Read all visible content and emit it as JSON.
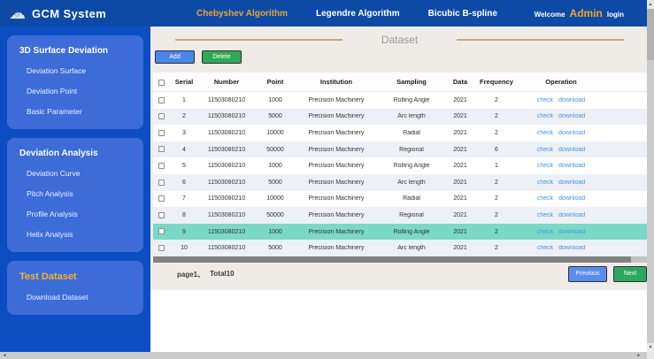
{
  "header": {
    "app_title": "GCM System",
    "nav": [
      {
        "label": "Chebyshev Algorithm",
        "active": true
      },
      {
        "label": "Legendre Algorithm",
        "active": false
      },
      {
        "label": "Bicubic B-spline",
        "active": false
      }
    ],
    "welcome": "Welcome",
    "user": "Admin",
    "login": "login"
  },
  "sidebar": {
    "sections": [
      {
        "title": "3D Surface Deviation",
        "accent": false,
        "items": [
          "Deviation Surface",
          "Deviation Point",
          "Basic Parameter"
        ]
      },
      {
        "title": "Deviation Analysis",
        "accent": false,
        "items": [
          "Deviation Curve",
          "Pitch Analysis",
          "Profile Analysis",
          "Helix Analysis"
        ]
      },
      {
        "title": "Test Dataset",
        "accent": true,
        "items": [
          "Download Dataset"
        ]
      }
    ]
  },
  "main": {
    "title": "Dataset",
    "toolbar": {
      "add": "Add",
      "delete": "Delete"
    },
    "table": {
      "headers": [
        "Serial",
        "Number",
        "Point",
        "Institution",
        "Sampling",
        "Data",
        "Frequency",
        "Operation"
      ],
      "operation_links": [
        "check",
        "download"
      ],
      "rows": [
        {
          "serial": "1",
          "number": "11503080210",
          "point": "1000",
          "institution": "Precision Machinery",
          "sampling": "Rolling Angle",
          "data": "2021",
          "frequency": "2",
          "highlighted": false
        },
        {
          "serial": "2",
          "number": "11503080210",
          "point": "5000",
          "institution": "Precision Machinery",
          "sampling": "Arc length",
          "data": "2021",
          "frequency": "2",
          "highlighted": false
        },
        {
          "serial": "3",
          "number": "11503080210",
          "point": "10000",
          "institution": "Precision Machinery",
          "sampling": "Radial",
          "data": "2021",
          "frequency": "2",
          "highlighted": false
        },
        {
          "serial": "4",
          "number": "11503080210",
          "point": "50000",
          "institution": "Precision Machinery",
          "sampling": "Regional",
          "data": "2021",
          "frequency": "6",
          "highlighted": false
        },
        {
          "serial": "5",
          "number": "11503080210",
          "point": "1000",
          "institution": "Precision Machinery",
          "sampling": "Rolling Angle",
          "data": "2021",
          "frequency": "1",
          "highlighted": false
        },
        {
          "serial": "6",
          "number": "11503080210",
          "point": "5000",
          "institution": "Precision Machinery",
          "sampling": "Arc length",
          "data": "2021",
          "frequency": "2",
          "highlighted": false
        },
        {
          "serial": "7",
          "number": "11503080210",
          "point": "10000",
          "institution": "Precision Machinery",
          "sampling": "Radial",
          "data": "2021",
          "frequency": "2",
          "highlighted": false
        },
        {
          "serial": "8",
          "number": "11503080210",
          "point": "50000",
          "institution": "Precision Machinery",
          "sampling": "Regional",
          "data": "2021",
          "frequency": "2",
          "highlighted": false
        },
        {
          "serial": "9",
          "number": "11503080210",
          "point": "1000",
          "institution": "Precision Machinery",
          "sampling": "Rolling Angle",
          "data": "2021",
          "frequency": "2",
          "highlighted": true
        },
        {
          "serial": "10",
          "number": "11503080210",
          "point": "5000",
          "institution": "Precision Machinery",
          "sampling": "Arc length",
          "data": "2021",
          "frequency": "2",
          "highlighted": false
        }
      ]
    },
    "pagination": {
      "page_label": "page1、",
      "total_label": "Total10",
      "previous": "Previous",
      "next": "Next"
    }
  },
  "colors": {
    "header_bg": "#0d4aa5",
    "sidebar_bg": "#0c4ec2",
    "sidebar_card_bg": "#3d6cd8",
    "accent_gold": "#e8a33b",
    "content_bg": "#efece8",
    "title_line": "#c9a582",
    "add_button": "#4a86e8",
    "delete_button": "#31a858",
    "row_alt": "#edf1f7",
    "row_highlight": "#79d9c6",
    "link": "#4a90e2",
    "previous_button": "#5a8cee",
    "next_button": "#2ea85e"
  }
}
